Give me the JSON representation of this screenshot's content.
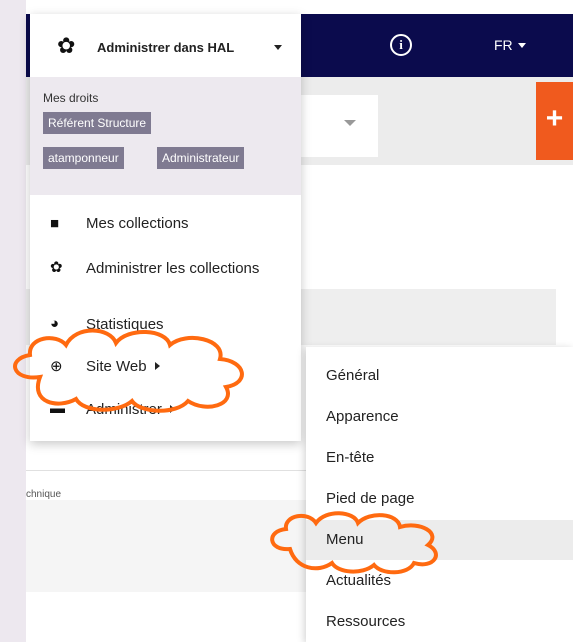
{
  "header": {
    "admin_title": "Administrer dans HAL",
    "language": "FR",
    "info_icon": "info-circle-icon",
    "add_icon": "+"
  },
  "rights": {
    "label": "Mes droits",
    "badges": [
      "Référent Structure",
      "atamponneur",
      "Administrateur"
    ]
  },
  "menu": {
    "items": [
      {
        "label": "Mes collections",
        "icon": "folder-icon"
      },
      {
        "label": "Administrer les collections",
        "icon": "gear-icon"
      },
      {
        "label": "Statistiques",
        "icon": "pie-chart-icon"
      },
      {
        "label": "Site Web",
        "icon": "globe-icon",
        "submenu": true
      },
      {
        "label": "Administrer",
        "icon": "briefcase-icon",
        "submenu": true
      }
    ]
  },
  "submenu": {
    "items": [
      "Général",
      "Apparence",
      "En-tête",
      "Pied de page",
      "Menu",
      "Actualités",
      "Ressources"
    ],
    "active": "Menu"
  },
  "background": {
    "fragment_text": "chnique"
  },
  "colors": {
    "navbar": "#0b0b4d",
    "accent_orange": "#f05a1e",
    "badge": "#7f7a91",
    "highlight_cloud": "#ff6a10"
  }
}
